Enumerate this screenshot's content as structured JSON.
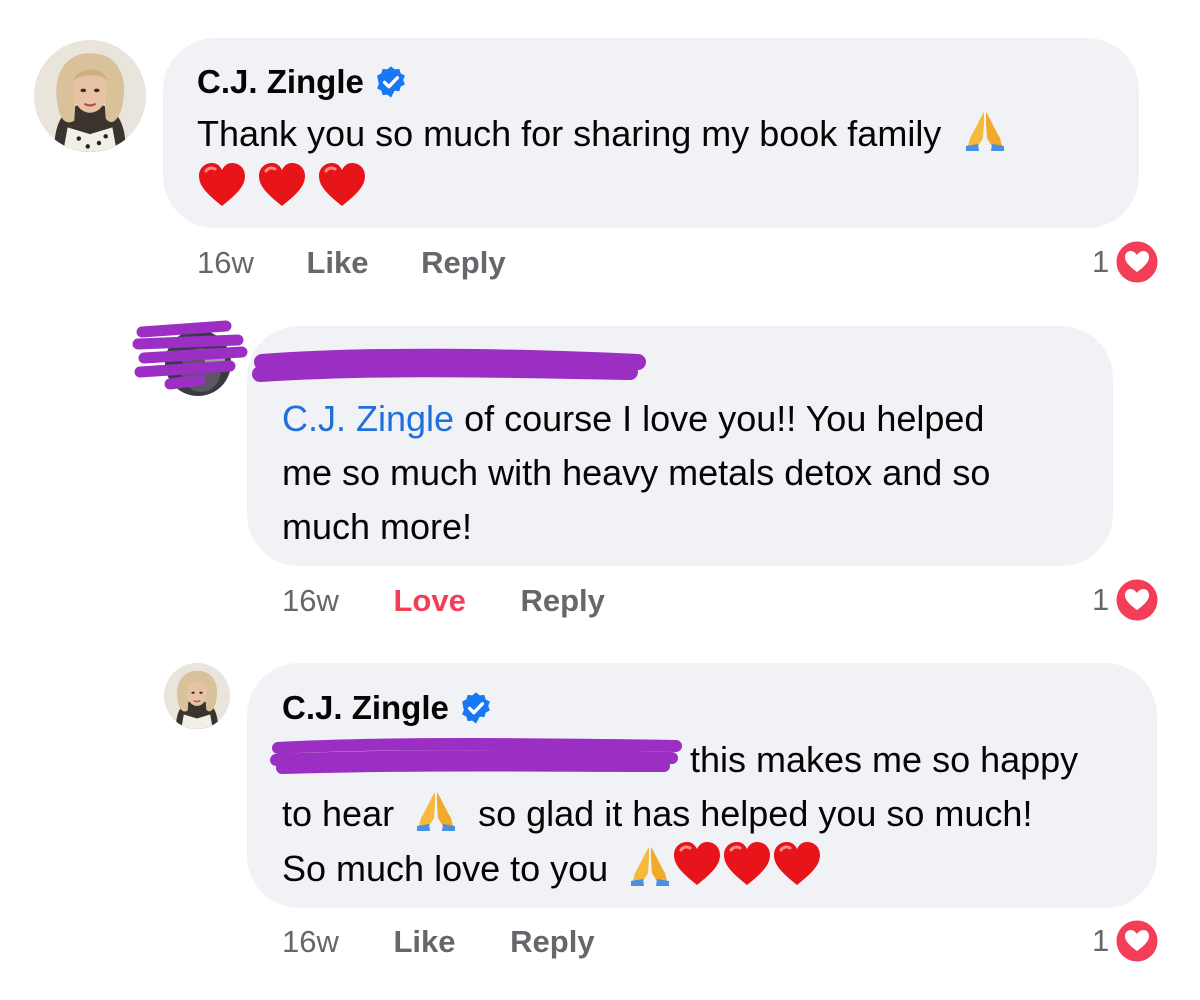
{
  "comments": [
    {
      "author": "C.J. Zingle",
      "verified": true,
      "text_line1": "Thank you so much for sharing my book family",
      "time": "16w",
      "like_label": "Like",
      "reply_label": "Reply",
      "reaction_count": "1",
      "reaction_icon": "love-reaction-icon"
    },
    {
      "author_redacted": true,
      "mention": "C.J. Zingle",
      "text_line1_rest": " of course I love you!! You helped",
      "text_line2": "me so much with heavy metals detox and so",
      "text_line3": "much more!",
      "time": "16w",
      "like_label": "Love",
      "reply_label": "Reply",
      "reaction_count": "1",
      "reaction_icon": "love-reaction-icon"
    },
    {
      "author": "C.J. Zingle",
      "verified": true,
      "text_line1": "this makes me so happy",
      "text_line2_a": "to hear",
      "text_line2_b": "so glad it has helped you so much!",
      "text_line3": "So much love to you",
      "time": "16w",
      "like_label": "Like",
      "reply_label": "Reply",
      "reaction_count": "1",
      "reaction_icon": "love-reaction-icon"
    }
  ],
  "colors": {
    "bubble": "#f0f2f5",
    "mention": "#216fdb",
    "meta": "#65676b",
    "love": "#f33e58",
    "verified": "#1877f2",
    "redaction": "#9b2fc4"
  }
}
